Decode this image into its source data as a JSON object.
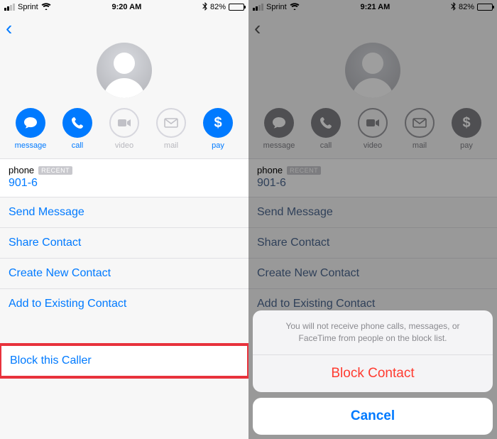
{
  "left": {
    "status": {
      "carrier": "Sprint",
      "time": "9:20 AM",
      "battery_pct": "82%",
      "bluetooth": "✱"
    },
    "actions": {
      "message": "message",
      "call": "call",
      "video": "video",
      "mail": "mail",
      "pay": "pay"
    },
    "phone": {
      "label": "phone",
      "recent_badge": "RECENT",
      "number": "901-6"
    },
    "menu": {
      "send_message": "Send Message",
      "share_contact": "Share Contact",
      "create_new": "Create New Contact",
      "add_existing": "Add to Existing Contact",
      "block": "Block this Caller"
    }
  },
  "right": {
    "status": {
      "carrier": "Sprint",
      "time": "9:21 AM",
      "battery_pct": "82%",
      "bluetooth": "✱"
    },
    "actions": {
      "message": "message",
      "call": "call",
      "video": "video",
      "mail": "mail",
      "pay": "pay"
    },
    "phone": {
      "label": "phone",
      "recent_badge": "RECENT",
      "number": "901-6"
    },
    "menu": {
      "send_message": "Send Message",
      "share_contact": "Share Contact",
      "create_new": "Create New Contact",
      "add_existing": "Add to Existing Contact"
    },
    "sheet": {
      "message": "You will not receive phone calls, messages, or FaceTime from people on the block list.",
      "block": "Block Contact",
      "cancel": "Cancel"
    }
  },
  "icons": {
    "message": "●",
    "call": "✆",
    "video": "■",
    "mail": "✉",
    "pay": "$"
  },
  "colors": {
    "blue": "#007aff",
    "red": "#ff3b30",
    "highlight": "#e8323c"
  }
}
